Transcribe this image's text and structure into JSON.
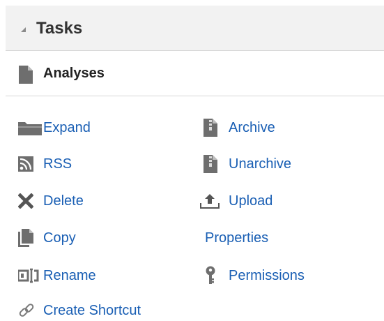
{
  "panel": {
    "title": "Tasks"
  },
  "section": {
    "title": "Analyses"
  },
  "tasks_left": [
    {
      "label": "Expand",
      "icon": "folder-icon"
    },
    {
      "label": "RSS",
      "icon": "rss-icon"
    },
    {
      "label": "Delete",
      "icon": "delete-x-icon"
    },
    {
      "label": "Copy",
      "icon": "copy-icon"
    },
    {
      "label": "Rename",
      "icon": "rename-icon"
    },
    {
      "label": "Create Shortcut",
      "icon": "link-icon"
    }
  ],
  "tasks_right": [
    {
      "label": "Archive",
      "icon": "archive-icon"
    },
    {
      "label": "Unarchive",
      "icon": "unarchive-icon"
    },
    {
      "label": "Upload",
      "icon": "upload-icon"
    },
    {
      "label": "Properties",
      "icon": ""
    },
    {
      "label": "Permissions",
      "icon": "key-icon"
    }
  ],
  "colors": {
    "link": "#1a5fb4",
    "icon": "#6e6e6e",
    "header_bg": "#f2f2f2"
  }
}
